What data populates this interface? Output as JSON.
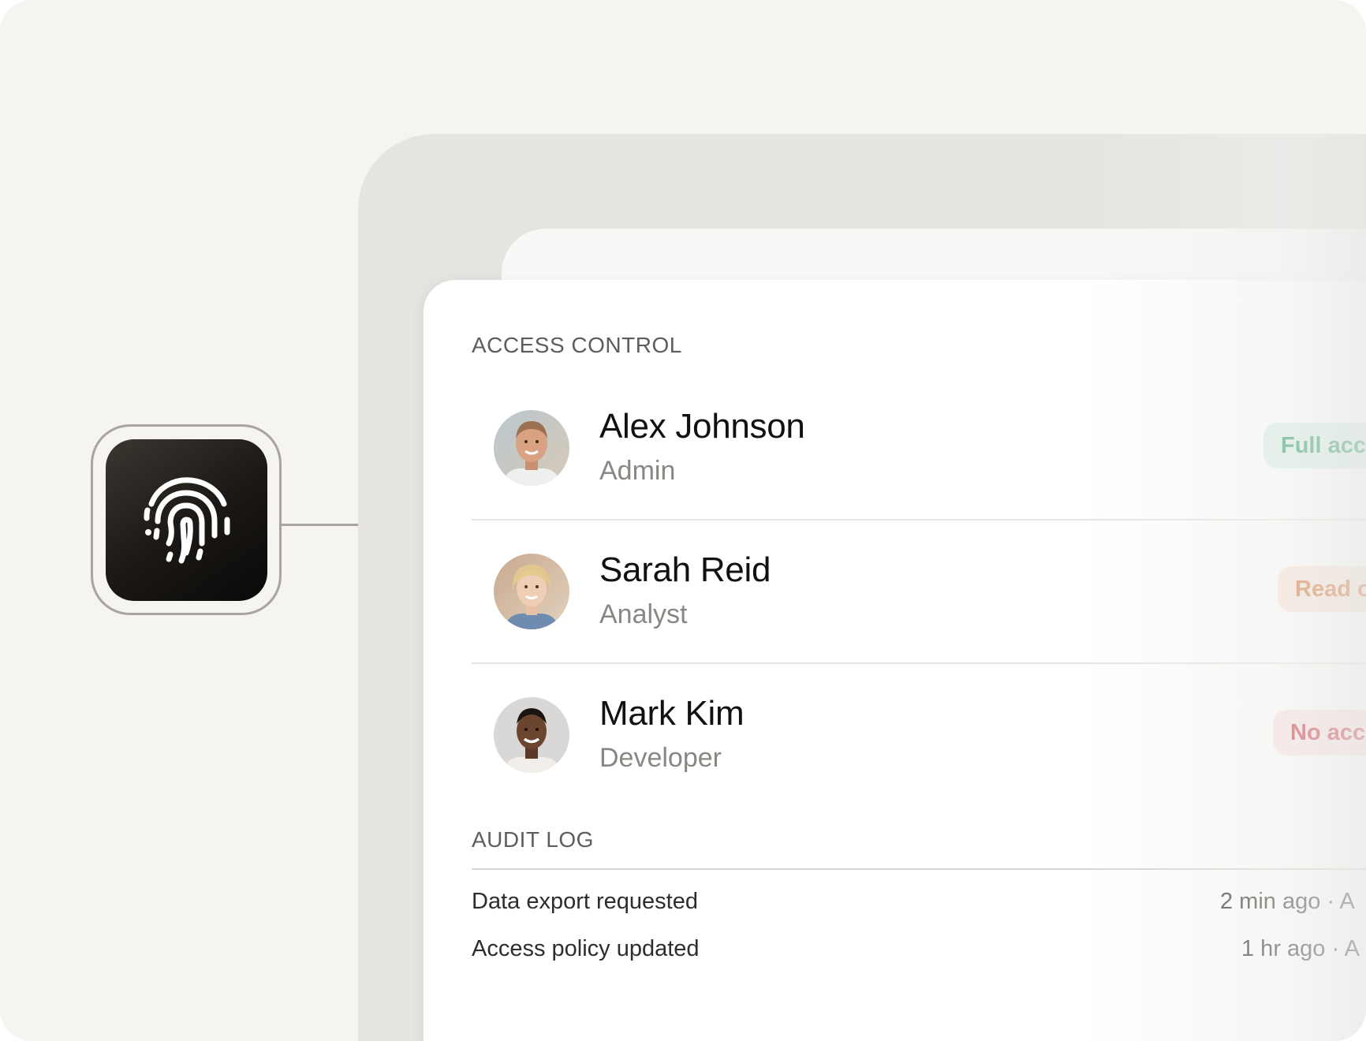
{
  "access_control": {
    "heading": "ACCESS CONTROL",
    "users": [
      {
        "name": "Alex Johnson",
        "role": "Admin",
        "access": "Full access",
        "access_color": "#17915f",
        "avatar": "alex-avatar"
      },
      {
        "name": "Sarah Reid",
        "role": "Analyst",
        "access": "Read only",
        "access_color": "#d2621d",
        "avatar": "sarah-avatar"
      },
      {
        "name": "Mark Kim",
        "role": "Developer",
        "access": "No access",
        "access_color": "#c21f2a",
        "avatar": "mark-avatar"
      }
    ]
  },
  "audit_log": {
    "heading": "AUDIT LOG",
    "entries": [
      {
        "event": "Data export requested",
        "meta": "2 min ago · A"
      },
      {
        "event": "Access policy updated",
        "meta": "1 hr ago · A"
      }
    ]
  },
  "icon": "fingerprint-icon",
  "colors": {
    "background": "#f5f4f0",
    "tile": "#1a1714",
    "full_access": "#17915f",
    "read_only": "#d2621d",
    "no_access": "#c21f2a"
  }
}
